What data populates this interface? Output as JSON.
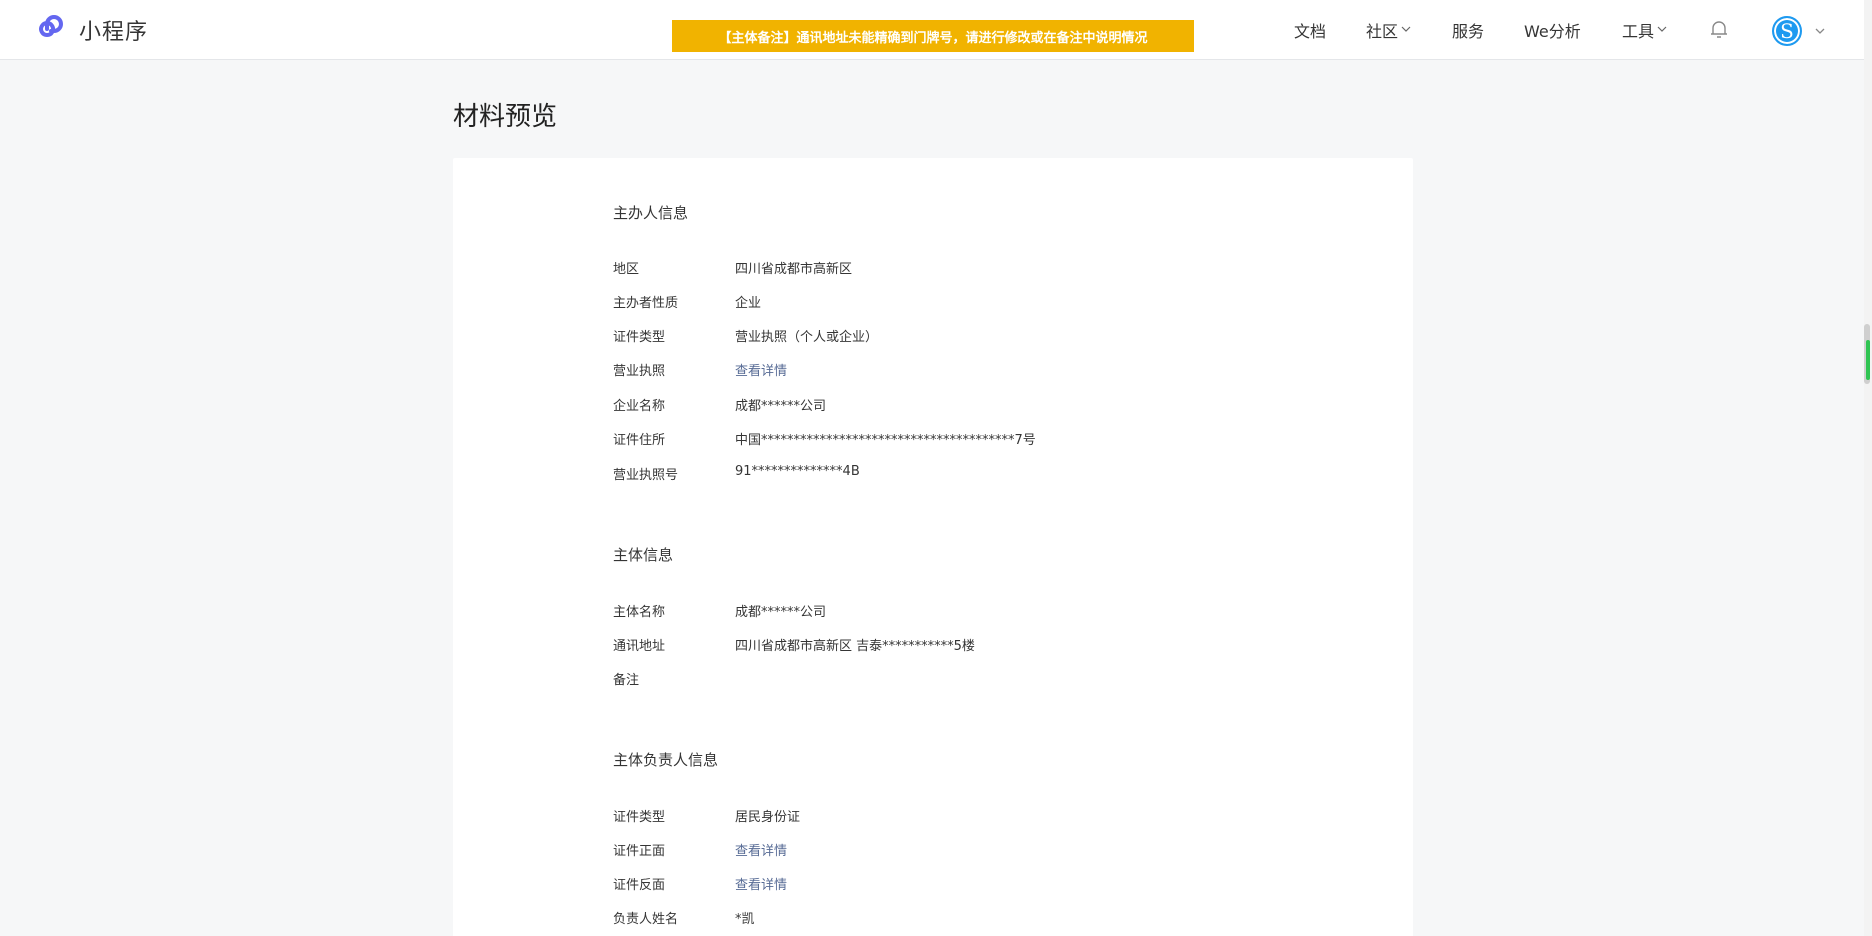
{
  "header": {
    "logo_text": "小程序",
    "notice": "【主体备注】通讯地址未能精确到门牌号，请进行修改或在备注中说明情况",
    "nav": {
      "docs": "文档",
      "community": "社区",
      "service": "服务",
      "we_analysis": "We分析",
      "tools": "工具"
    },
    "avatar_letter": "S"
  },
  "page": {
    "title": "材料预览"
  },
  "sections": {
    "organizer": {
      "title": "主办人信息",
      "rows": [
        {
          "label": "地区",
          "value": "四川省成都市高新区"
        },
        {
          "label": "主办者性质",
          "value": "企业"
        },
        {
          "label": "证件类型",
          "value": "营业执照（个人或企业）"
        },
        {
          "label": "营业执照",
          "value": "查看详情"
        },
        {
          "label": "企业名称",
          "value": "成都******公司"
        },
        {
          "label": "证件住所",
          "value": "中国***************************************7号"
        },
        {
          "label": "营业执照号",
          "value": "91**************4B"
        }
      ]
    },
    "subject": {
      "title": "主体信息",
      "rows": [
        {
          "label": "主体名称",
          "value": "成都******公司"
        },
        {
          "label": "通讯地址",
          "value": "四川省成都市高新区 吉泰***********5楼"
        },
        {
          "label": "备注",
          "value": ""
        }
      ]
    },
    "principal": {
      "title": "主体负责人信息",
      "rows": [
        {
          "label": "证件类型",
          "value": "居民身份证"
        },
        {
          "label": "证件正面",
          "value": "查看详情"
        },
        {
          "label": "证件反面",
          "value": "查看详情"
        },
        {
          "label": "负责人姓名",
          "value": "*凯"
        }
      ]
    }
  },
  "colors": {
    "notice_bg": "#f1b300",
    "link": "#576b95",
    "brand": "#6467f0",
    "avatar": "#1e9af0"
  }
}
